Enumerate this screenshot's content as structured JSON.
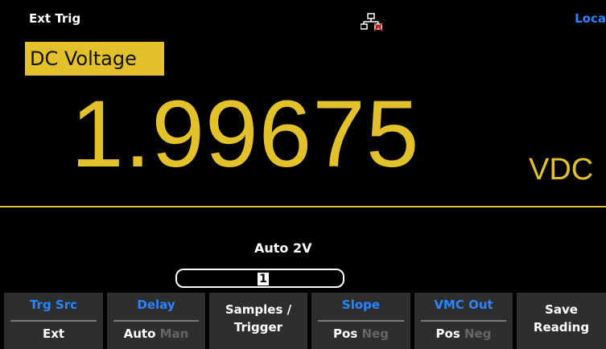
{
  "status": {
    "mode": "Ext Trig",
    "remote": "Loca"
  },
  "function": {
    "label": "DC Voltage"
  },
  "reading": {
    "value": "1.99675",
    "unit": "VDC"
  },
  "range": {
    "label": "Auto 2V"
  },
  "input": {
    "value": "1"
  },
  "softkeys": [
    {
      "title": "Trg Src",
      "value": "Ext"
    },
    {
      "title": "Delay",
      "option_active": "Auto",
      "option_inactive": "Man"
    },
    {
      "line1": "Samples /",
      "line2": "Trigger"
    },
    {
      "title": "Slope",
      "option_active": "Pos",
      "option_inactive": "Neg"
    },
    {
      "title": "VMC Out",
      "option_active": "Pos",
      "option_inactive": "Neg"
    },
    {
      "line1": "Save",
      "line2": "Reading"
    }
  ],
  "colors": {
    "accent": "#e2c12a",
    "title": "#2a84ff",
    "softkey_bg": "#2e2e2e"
  },
  "icons": {
    "network": "network-disconnected-icon"
  }
}
